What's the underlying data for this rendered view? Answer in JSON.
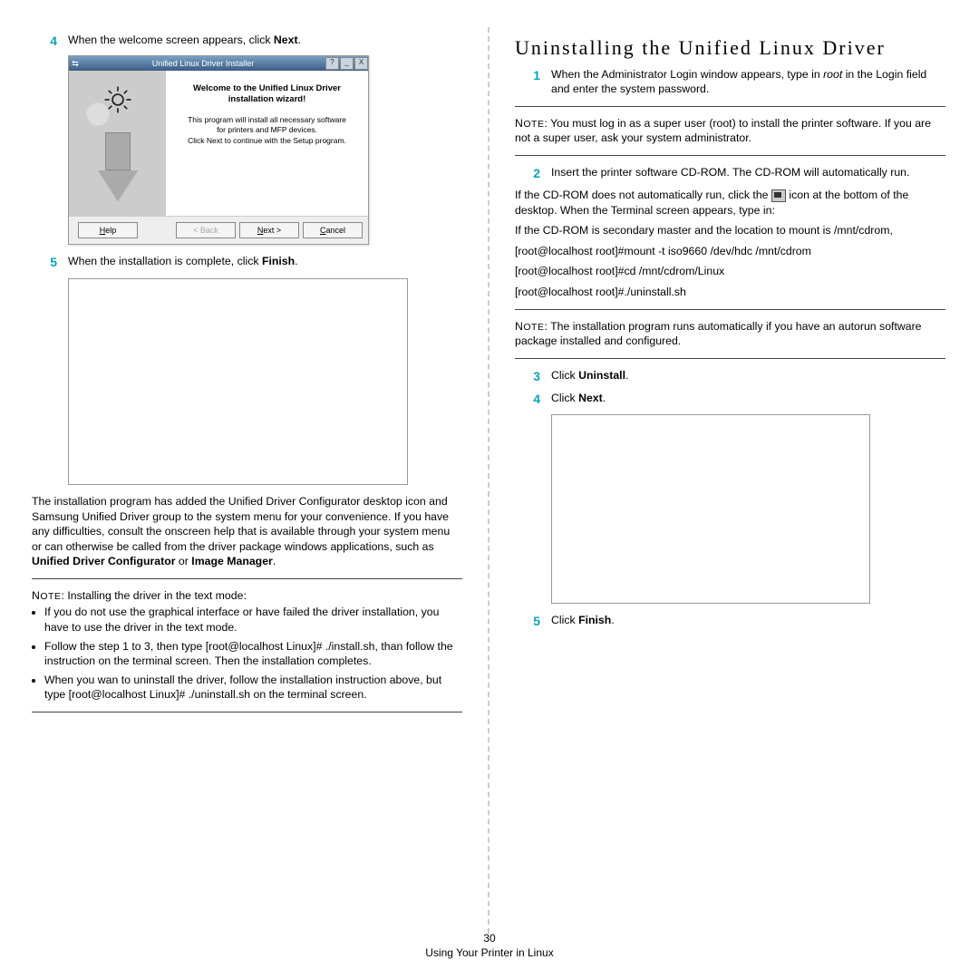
{
  "left": {
    "step4": {
      "num": "4",
      "pre": "When the welcome screen appears, click ",
      "bold": "Next",
      "post": "."
    },
    "installer": {
      "titlebar": "Unified Linux Driver Installer",
      "tb_help": "?",
      "tb_min": "_",
      "tb_close": "X",
      "wiz_title_l1": "Welcome to the Unified Linux Driver",
      "wiz_title_l2": "installation wizard!",
      "wiz_text_l1": "This program will install all necessary software",
      "wiz_text_l2": "for printers and MFP devices.",
      "wiz_text_l3": "Click Next to continue with the Setup program.",
      "btn_help": "Help",
      "btn_back": "< Back",
      "btn_next": "Next >",
      "btn_cancel": "Cancel"
    },
    "step5": {
      "num": "5",
      "pre": "When the installation is complete, click ",
      "bold": "Finish",
      "post": "."
    },
    "afterbox": {
      "p1a": "The installation program has added the Unified Driver Configurator desktop icon and Samsung Unified Driver group to the system menu for your convenience. If you have any difficulties, consult the onscreen help that is available through your system menu or can otherwise be called from the driver package windows applications, such as ",
      "p1b": "Unified Driver Configurator",
      "p1c": " or ",
      "p1d": "Image Manager",
      "p1e": "."
    },
    "note": {
      "label": "Note",
      "intro": ": Installing the driver in the text mode:",
      "b1": "If you do not use the graphical interface or have failed the driver installation, you have to use the driver in the text mode.",
      "b2": "Follow the step 1 to 3, then type [root@localhost Linux]# ./install.sh, than follow the instruction on the terminal screen. Then the installation completes.",
      "b3": "When you wan to uninstall the driver, follow the installation instruction above, but type [root@localhost Linux]# ./uninstall.sh on the terminal screen."
    }
  },
  "right": {
    "heading": "Uninstalling the Unified Linux Driver",
    "step1": {
      "num": "1",
      "l1a": "When the Administrator Login window appears, type in ",
      "root": "root",
      "l1b": " in the Login field and enter the system password."
    },
    "note1": {
      "label": "Note",
      "text": ": You must log in as a super user (root) to install the printer software. If you are not a super user, ask your system administrator."
    },
    "step2": {
      "num": "2",
      "l1": "Insert the printer software CD-ROM. The CD-ROM will automatically run.",
      "p2a": "If the CD-ROM does not automatically run, click the ",
      "p2b": " icon at the bottom of the desktop. When the Terminal screen appears, type in:",
      "p3": "If the CD-ROM is secondary master and the location to mount is /mnt/cdrom,",
      "c1": "[root@localhost root]#mount -t iso9660 /dev/hdc /mnt/cdrom",
      "c2": "[root@localhost root]#cd /mnt/cdrom/Linux",
      "c3": "[root@localhost root]#./uninstall.sh"
    },
    "note2": {
      "label": "Note",
      "text": ": The installation program runs automatically if you have an autorun software package installed and configured."
    },
    "step3": {
      "num": "3",
      "pre": "Click ",
      "bold": "Uninstall",
      "post": "."
    },
    "step4": {
      "num": "4",
      "pre": "Click ",
      "bold": "Next",
      "post": "."
    },
    "step5": {
      "num": "5",
      "pre": "Click ",
      "bold": "Finish",
      "post": "."
    }
  },
  "footer": {
    "page": "30",
    "section": "Using Your Printer in Linux"
  }
}
